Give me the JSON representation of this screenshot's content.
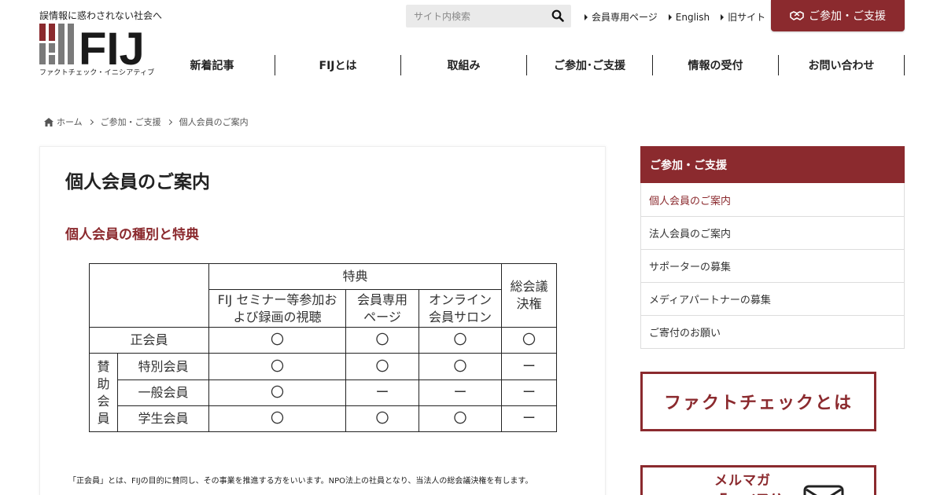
{
  "header": {
    "tagline": "誤情報に惑わされない社会へ",
    "logo_text": "FIJ",
    "logo_sub": "ファクトチェック・イニシアティブ",
    "search_placeholder": "サイト内検索",
    "top_links": [
      "会員専用ページ",
      "English",
      "旧サイト"
    ],
    "cta_label": "ご参加・ご支援"
  },
  "nav": [
    "新着記事",
    "FIJとは",
    "取組み",
    "ご参加･ご支援",
    "情報の受付",
    "お問い合わせ"
  ],
  "breadcrumb": [
    "ホーム",
    "ご参加・ご支援",
    "個人会員のご案内"
  ],
  "main": {
    "title": "個人会員のご案内",
    "section_title": "個人会員の種別と特典",
    "table": {
      "benefits_header": "特典",
      "col1": "FIJ セミナー等参加および録画の視聴",
      "col2": "会員専用ページ",
      "col3": "オンライン会員サロン",
      "col4": "総会議決権",
      "regular": "正会員",
      "supporting_group": "賛助会員",
      "rows": [
        {
          "label": "正会員",
          "v": [
            "〇",
            "〇",
            "〇",
            "〇"
          ]
        },
        {
          "label": "特別会員",
          "v": [
            "〇",
            "〇",
            "〇",
            "ー"
          ]
        },
        {
          "label": "一般会員",
          "v": [
            "〇",
            "ー",
            "ー",
            "ー"
          ]
        },
        {
          "label": "学生会員",
          "v": [
            "〇",
            "〇",
            "〇",
            "ー"
          ]
        }
      ]
    },
    "note": "「正会員」とは、FIJの目的に賛同し、その事業を推進する方をいいます。NPO法上の社員となり、当法人の総会議決権を有します。"
  },
  "sidebar": {
    "heading": "ご参加・ご支援",
    "items": [
      "個人会員のご案内",
      "法人会員のご案内",
      "サポーターの募集",
      "メディアパートナーの募集",
      "ご寄付のお願い"
    ],
    "banner_fc": "ファクトチェックとは",
    "banner_mail_l1": "メルマガ",
    "banner_mail_l2": "「FIJ通信」"
  },
  "colors": {
    "accent": "#8b2a2e",
    "logo_gray": "#7a7a7a"
  }
}
